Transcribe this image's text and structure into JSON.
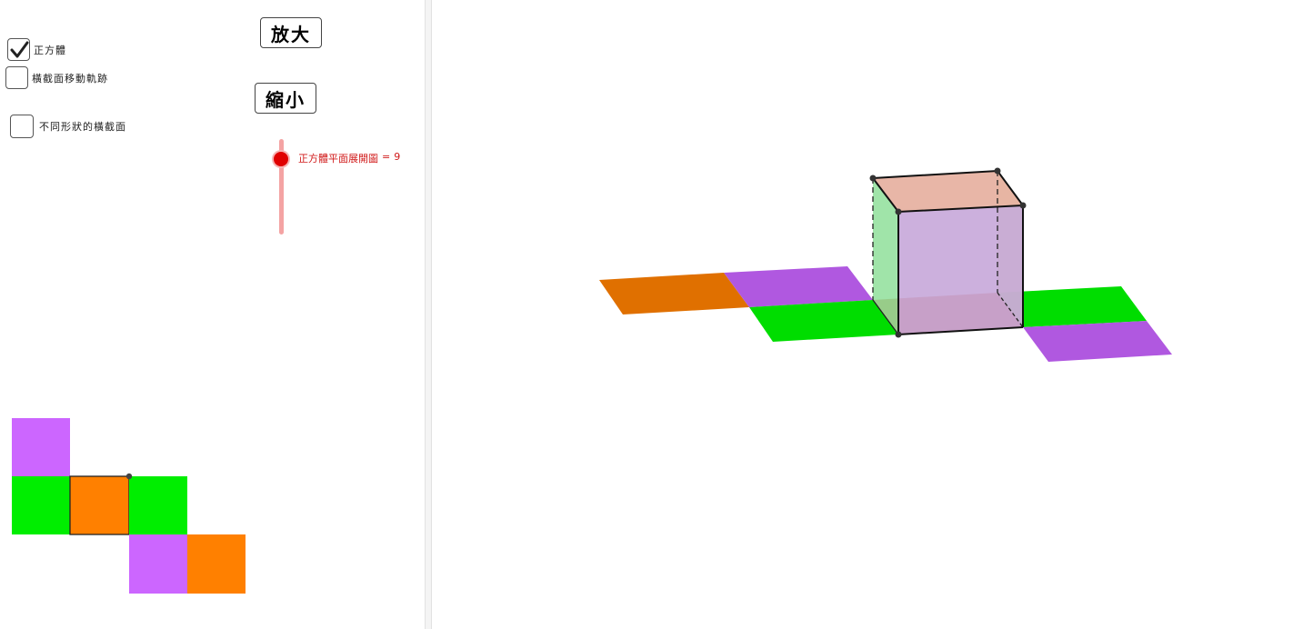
{
  "checkboxes": [
    {
      "label": "正方體",
      "checked": true
    },
    {
      "label": "橫截面移動軌跡",
      "checked": false
    },
    {
      "label": "不同形狀的橫截面",
      "checked": false
    }
  ],
  "buttons": {
    "zoom_in": "放大",
    "zoom_out": "縮小"
  },
  "slider": {
    "label": "正方體平面展開圖",
    "equals": "=",
    "value": "9"
  },
  "colors": {
    "purple": "#cc66ff",
    "green": "#00ee00",
    "orange": "#ff8000",
    "slider_red": "#e00000",
    "slider_track": "#f4a3a3"
  },
  "net_2d": {
    "rows": [
      [
        "purple",
        null,
        null,
        null
      ],
      [
        "green",
        "orange",
        "green",
        null
      ],
      [
        null,
        null,
        "purple",
        "orange"
      ]
    ]
  },
  "view_3d": {
    "net_layout": "unfolded faces around cube base",
    "face_colors": [
      "orange",
      "purple",
      "green",
      "green",
      "purple"
    ]
  }
}
